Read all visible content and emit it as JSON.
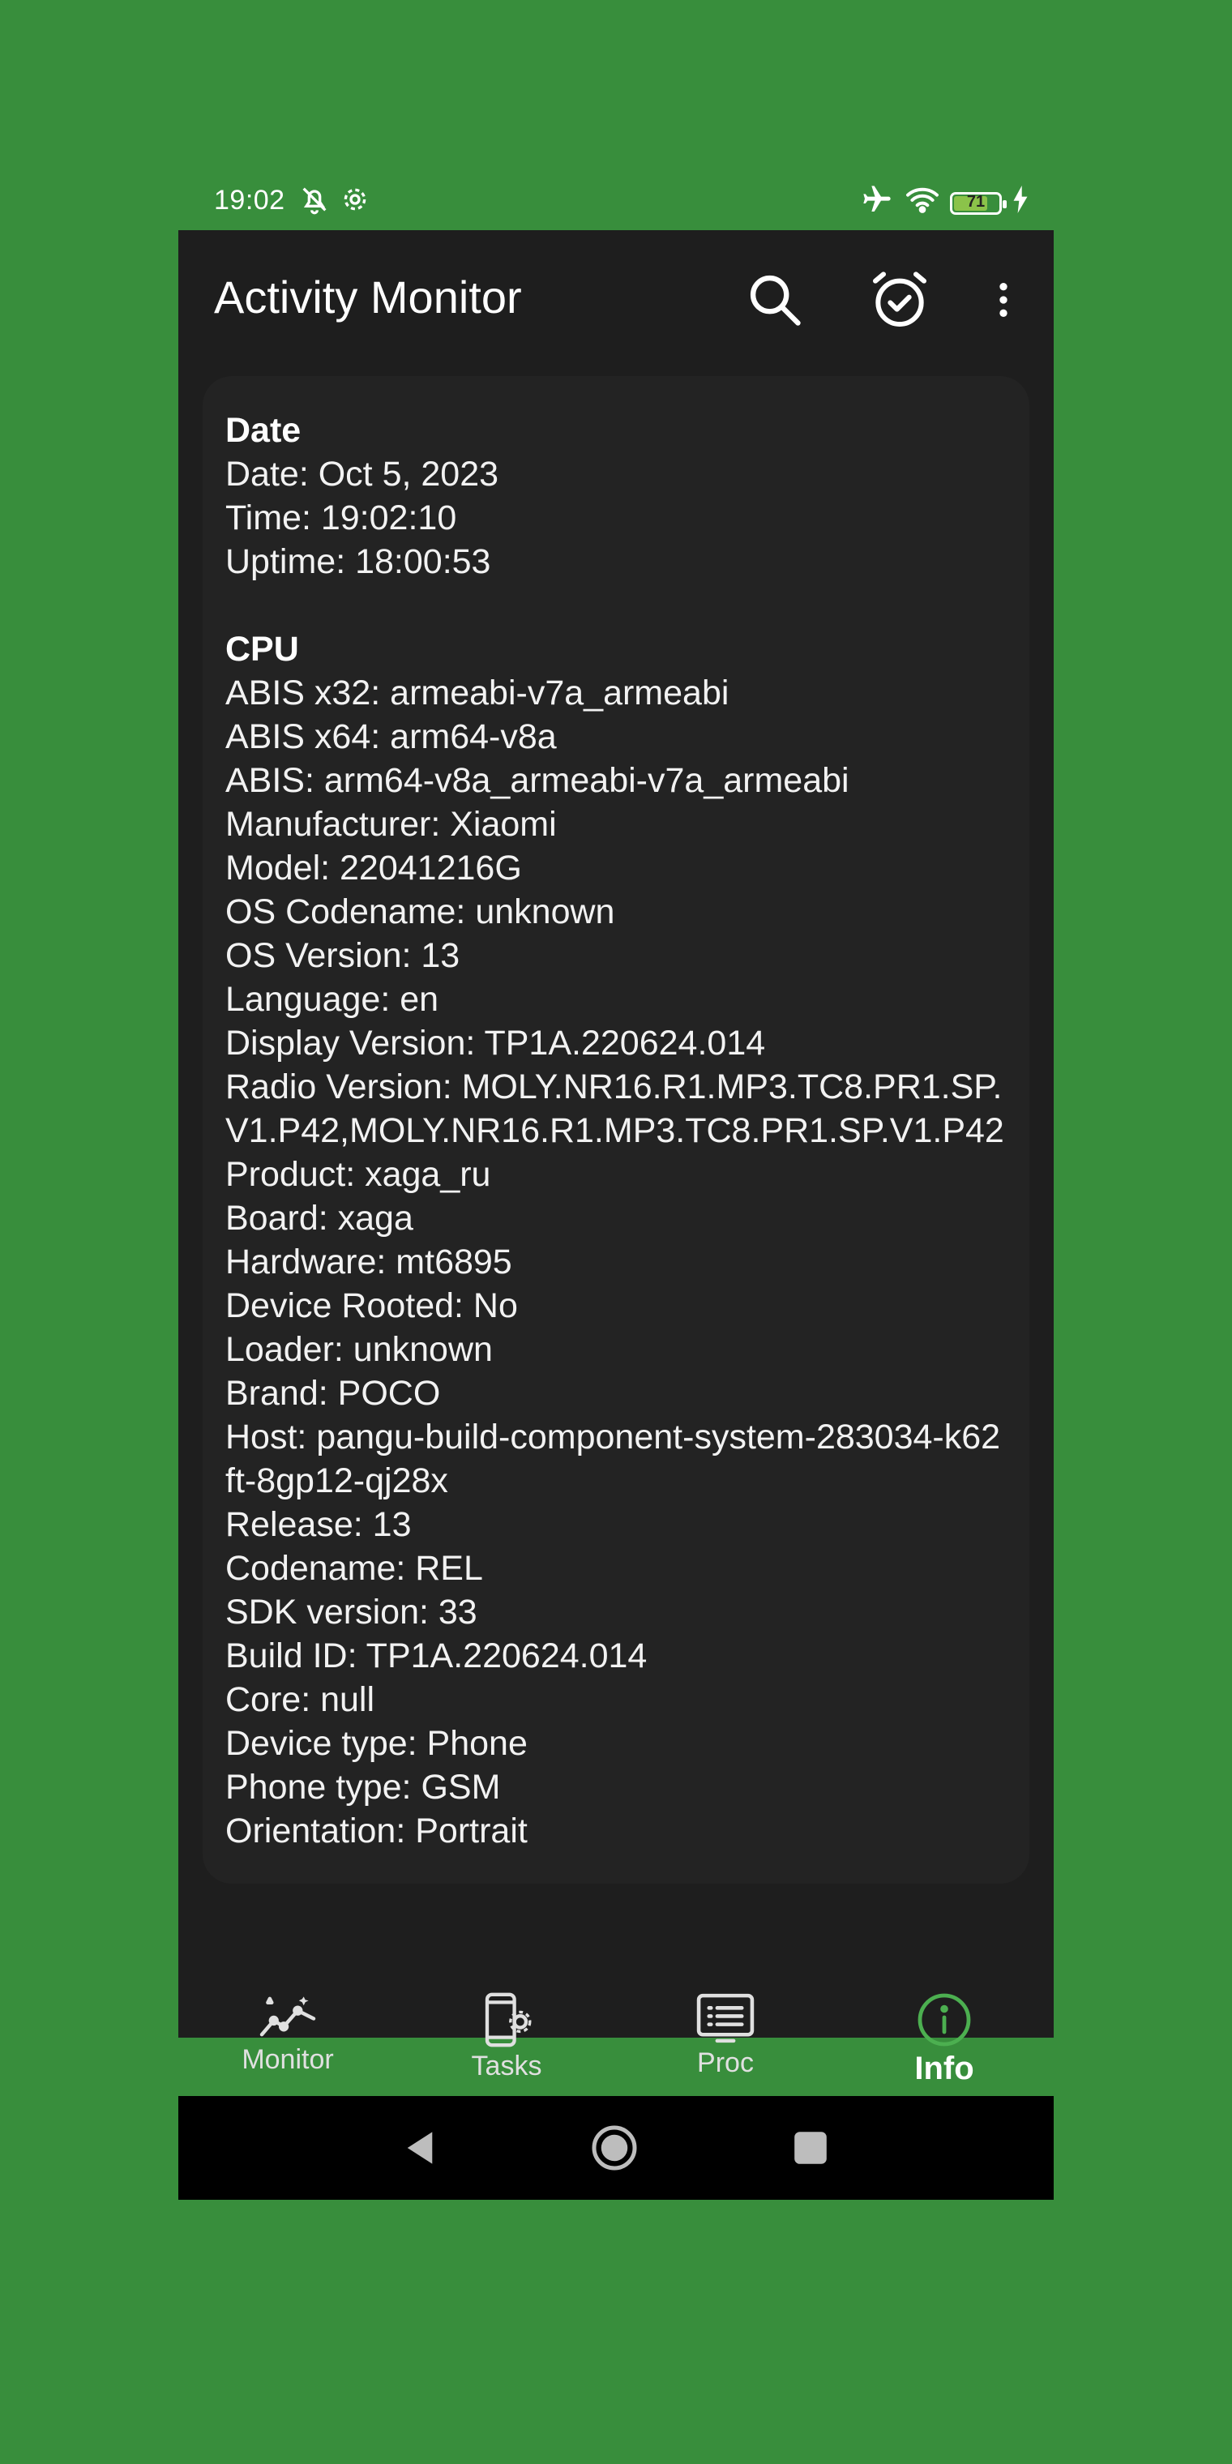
{
  "status_bar": {
    "time": "19:02",
    "battery_level": "71",
    "icons_left": [
      "bell-off-icon",
      "gear-icon"
    ],
    "icons_right": [
      "airplane-icon",
      "wifi-icon",
      "battery-icon",
      "charging-icon"
    ]
  },
  "appbar": {
    "title": "Activity Monitor",
    "actions": [
      "search-icon",
      "alarm-check-icon",
      "more-vert-icon"
    ]
  },
  "sections": [
    {
      "title": "Date",
      "lines": [
        "Date: Oct 5, 2023",
        "Time: 19:02:10",
        "Uptime: 18:00:53"
      ]
    },
    {
      "title": "CPU",
      "lines": [
        "ABIS x32: armeabi-v7a_armeabi",
        "ABIS x64: arm64-v8a",
        "ABIS: arm64-v8a_armeabi-v7a_armeabi",
        "Manufacturer: Xiaomi",
        "Model: 22041216G",
        "OS Codename: unknown",
        "OS Version: 13",
        "Language: en",
        "Display Version: TP1A.220624.014",
        "Radio Version: MOLY.NR16.R1.MP3.TC8.PR1.SP.V1.P42,MOLY.NR16.R1.MP3.TC8.PR1.SP.V1.P42",
        "Product: xaga_ru",
        "Board: xaga",
        "Hardware: mt6895",
        "Device Rooted: No",
        "Loader: unknown",
        "Brand: POCO",
        "Host: pangu-build-component-system-283034-k62ft-8gp12-qj28x",
        "Release: 13",
        "Codename: REL",
        "SDK version: 33",
        "Build ID: TP1A.220624.014",
        "Core: null",
        "Device type: Phone",
        "Phone type: GSM",
        "Orientation: Portrait"
      ]
    }
  ],
  "bottom_nav": [
    {
      "label": "Monitor",
      "icon": "trending-chart-icon",
      "active": false
    },
    {
      "label": "Tasks",
      "icon": "phone-settings-icon",
      "active": false
    },
    {
      "label": "Proc",
      "icon": "list-monitor-icon",
      "active": false
    },
    {
      "label": "Info",
      "icon": "info-icon",
      "active": true
    }
  ],
  "colors": {
    "background": "#388e3c",
    "app_background": "#1e1e1e",
    "card": "#232323",
    "accent": "#4caf50"
  }
}
